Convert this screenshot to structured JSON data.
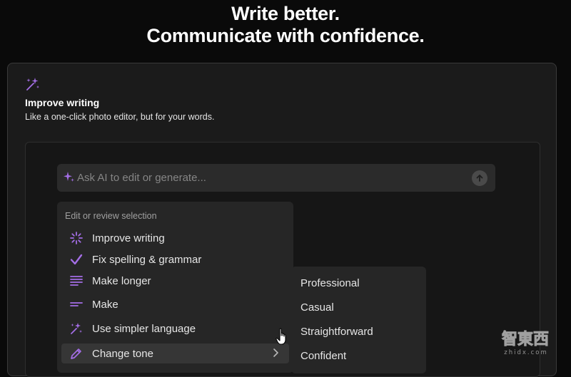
{
  "hero": {
    "line1": "Write better.",
    "line2": "Communicate with confidence."
  },
  "card": {
    "icon": "magic-wand-sparkle-icon",
    "title": "Improve writing",
    "subtitle": "Like a one-click photo editor, but for your words."
  },
  "ask": {
    "placeholder": "Ask AI to edit or generate...",
    "icon": "sparkle-icon",
    "send_icon": "arrow-up-icon"
  },
  "menu": {
    "header": "Edit or review selection",
    "items": [
      {
        "label": "Improve writing",
        "icon": "sparkle-burst-icon"
      },
      {
        "label": "Fix spelling & grammar",
        "icon": "checkmark-icon"
      },
      {
        "label": "Make longer",
        "icon": "lines-long-icon"
      },
      {
        "label": "Make",
        "icon": "lines-short-icon"
      },
      {
        "label": "Use simpler language",
        "icon": "magic-sparkle-icon"
      },
      {
        "label": "Change tone",
        "icon": "pen-icon",
        "active": true
      }
    ]
  },
  "tone_submenu": {
    "items": [
      "Professional",
      "Casual",
      "Straightforward",
      "Confident"
    ]
  },
  "watermark": {
    "text": "智東西",
    "sub": "zhidx.com"
  },
  "colors": {
    "accent": "#a46ee6",
    "background": "#0a0a0a",
    "card": "#1b1b1b",
    "menu": "#262626"
  }
}
